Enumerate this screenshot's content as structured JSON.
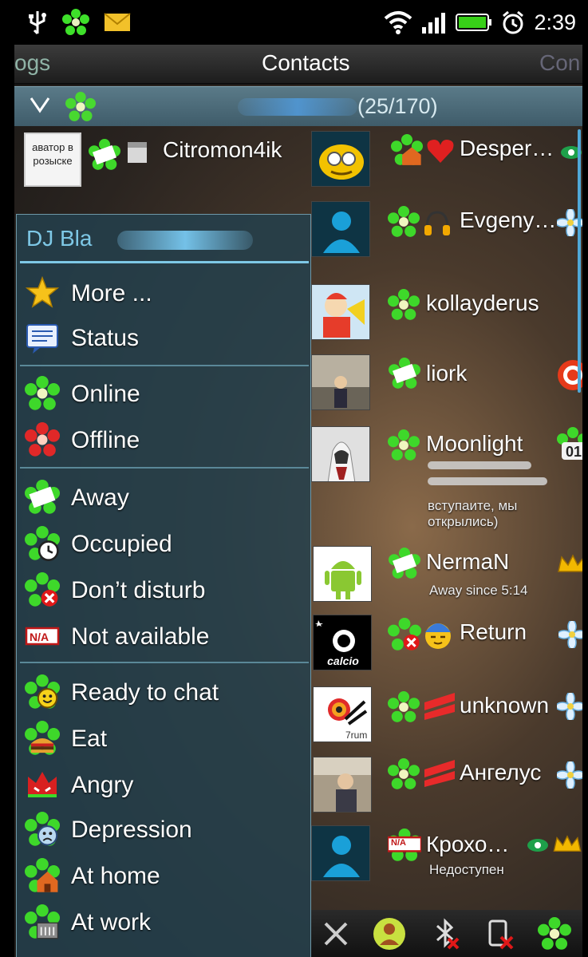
{
  "status_bar": {
    "time": "2:39",
    "left_icons": [
      "usb-icon",
      "icq-flower-icon",
      "mail-icon"
    ],
    "right_icons": [
      "wifi-icon",
      "signal-icon",
      "battery-icon",
      "alarm-icon"
    ]
  },
  "tabs": {
    "left": "ogs",
    "center": "Contacts",
    "right": "Con"
  },
  "group": {
    "count": "(25/170)"
  },
  "contacts_left": [
    {
      "name": "Citromon4ik",
      "avatar_text": "аватор в розыске"
    }
  ],
  "contacts_right": [
    {
      "name": "Desper…"
    },
    {
      "name": "Evgeny…"
    },
    {
      "name": "kollayderus"
    },
    {
      "name": "liork"
    },
    {
      "name": "Moonlight",
      "status_text": "вступаите, мы открылись)"
    },
    {
      "name": "NermaN",
      "status_text": "Away since 5:14"
    },
    {
      "name": "Return"
    },
    {
      "name": "unknown"
    },
    {
      "name": "Ангелус"
    },
    {
      "name": "Крохо…",
      "status_text": "Недоступен",
      "status_badge": "N/A"
    }
  ],
  "menu": {
    "title": "DJ Bla",
    "items": [
      {
        "label": "More ...",
        "icon": "star-icon"
      },
      {
        "label": "Status",
        "icon": "message-icon"
      },
      {
        "label": "Online",
        "icon": "online-flower-icon"
      },
      {
        "label": "Offline",
        "icon": "offline-flower-icon"
      },
      {
        "label": "Away",
        "icon": "away-icon"
      },
      {
        "label": "Occupied",
        "icon": "occupied-icon"
      },
      {
        "label": "Don’t disturb",
        "icon": "dont-disturb-icon"
      },
      {
        "label": "Not available",
        "icon": "not-available-icon"
      },
      {
        "label": "Ready to chat",
        "icon": "ready-to-chat-icon"
      },
      {
        "label": "Eat",
        "icon": "eat-icon"
      },
      {
        "label": "Angry",
        "icon": "angry-icon"
      },
      {
        "label": "Depression",
        "icon": "depression-icon"
      },
      {
        "label": "At home",
        "icon": "at-home-icon"
      },
      {
        "label": "At work",
        "icon": "at-work-icon"
      }
    ],
    "na_badge": "N/A"
  },
  "colors": {
    "icq_green": "#4fd23a",
    "menu_accent": "#7ec8e6",
    "group_bar": "#4a6a78"
  }
}
